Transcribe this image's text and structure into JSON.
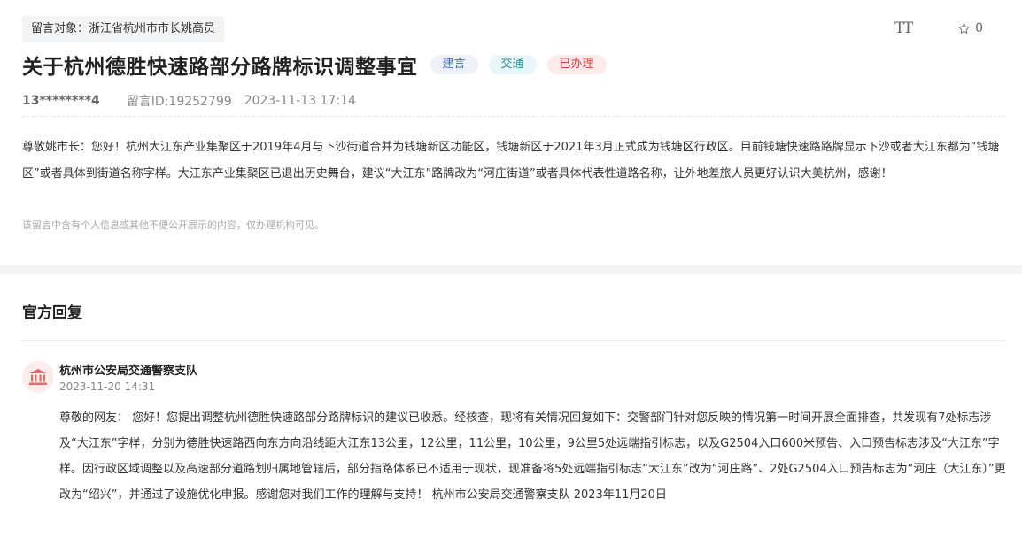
{
  "message": {
    "recipient": "留言对象：浙江省杭州市市长姚高员",
    "font_size_label": "TT",
    "favorite_count": "0",
    "title": "关于杭州德胜快速路部分路牌标识调整事宜",
    "tags": [
      {
        "label": "建言",
        "color": "#3a6fb6"
      },
      {
        "label": "交通",
        "color": "#2e8b9a"
      },
      {
        "label": "已办理",
        "color": "#d93a3a"
      }
    ],
    "user": "13********4",
    "message_id": "留言ID:19252799",
    "datetime": "2023-11-13 17:14",
    "content": "尊敬姚市长：您好！杭州大江东产业集聚区于2019年4月与下沙街道合并为钱塘新区功能区，钱塘新区于2021年3月正式成为钱塘区行政区。目前钱塘快速路路牌显示下沙或者大江东都为“钱塘区”或者具体到街道名称字样。大江东产业集聚区已退出历史舞台，建议“大江东”路牌改为“河庄街道”或者具体代表性道路名称，让外地差旅人员更好认识大美杭州，感谢！",
    "privacy_note": "该留言中含有个人信息或其他不便公开展示的内容，仅办理机构可见。"
  },
  "reply": {
    "section_title": "官方回复",
    "org_name": "杭州市公安局交通警察支队",
    "datetime": "2023-11-20 14:31",
    "content": "尊敬的网友： 您好！您提出调整杭州德胜快速路部分路牌标识的建议已收悉。经核查，现将有关情况回复如下：交警部门针对您反映的情况第一时间开展全面排查，共发现有7处标志涉及“大江东”字样，分别为德胜快速路西向东方向沿线距大江东13公里，12公里，11公里，10公里，9公里5处远端指引标志，以及G2504入口600米预告、入口预告标志涉及“大江东”字样。因行政区域调整以及高速部分道路划归属地管辖后，部分指路体系已不适用于现状，现准备将5处远端指引标志“大江东”改为“河庄路”、2处G2504入口预告标志为“河庄（大江东）”更改为“绍兴”，并通过了设施优化申报。感谢您对我们工作的理解与支持！ 杭州市公安局交通警察支队 2023年11月20日"
  },
  "icons": {
    "font_size": "font-size-icon",
    "star": "star-icon",
    "organization": "government-building-icon"
  }
}
